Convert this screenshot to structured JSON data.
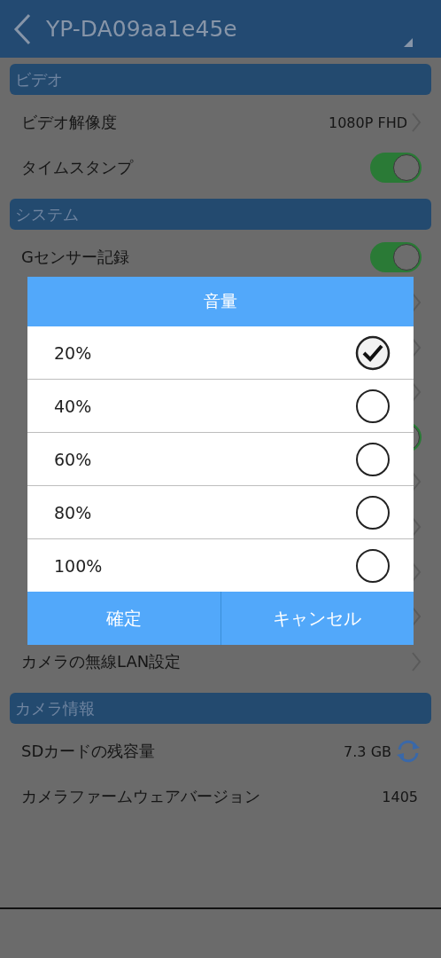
{
  "header": {
    "title": "YP-DA09aa1e45e"
  },
  "sections": [
    {
      "title": "ビデオ",
      "rows": [
        {
          "kind": "link",
          "label": "ビデオ解像度",
          "value": "1080P FHD"
        },
        {
          "kind": "toggle",
          "label": "タイムスタンプ",
          "on": true
        }
      ]
    },
    {
      "title": "システム",
      "rows": [
        {
          "kind": "toggle",
          "label": "Gセンサー記録",
          "on": true
        },
        {
          "kind": "link"
        },
        {
          "kind": "link"
        },
        {
          "kind": "link"
        },
        {
          "kind": "toggle",
          "on": true
        },
        {
          "kind": "link"
        },
        {
          "kind": "link"
        },
        {
          "kind": "link"
        },
        {
          "kind": "link"
        },
        {
          "kind": "link",
          "label": "カメラの無線LAN設定"
        }
      ]
    },
    {
      "title": "カメラ情報",
      "rows": [
        {
          "kind": "refresh",
          "label": "SDカードの残容量",
          "value": "7.3 GB"
        },
        {
          "kind": "info",
          "label": "カメラファームウェアバージョン",
          "value": "1405"
        }
      ]
    }
  ],
  "dialog": {
    "title": "音量",
    "options": [
      {
        "label": "20%",
        "selected": true
      },
      {
        "label": "40%",
        "selected": false
      },
      {
        "label": "60%",
        "selected": false
      },
      {
        "label": "80%",
        "selected": false
      },
      {
        "label": "100%",
        "selected": false
      }
    ],
    "buttons": [
      "確定",
      "キャンセル"
    ]
  }
}
